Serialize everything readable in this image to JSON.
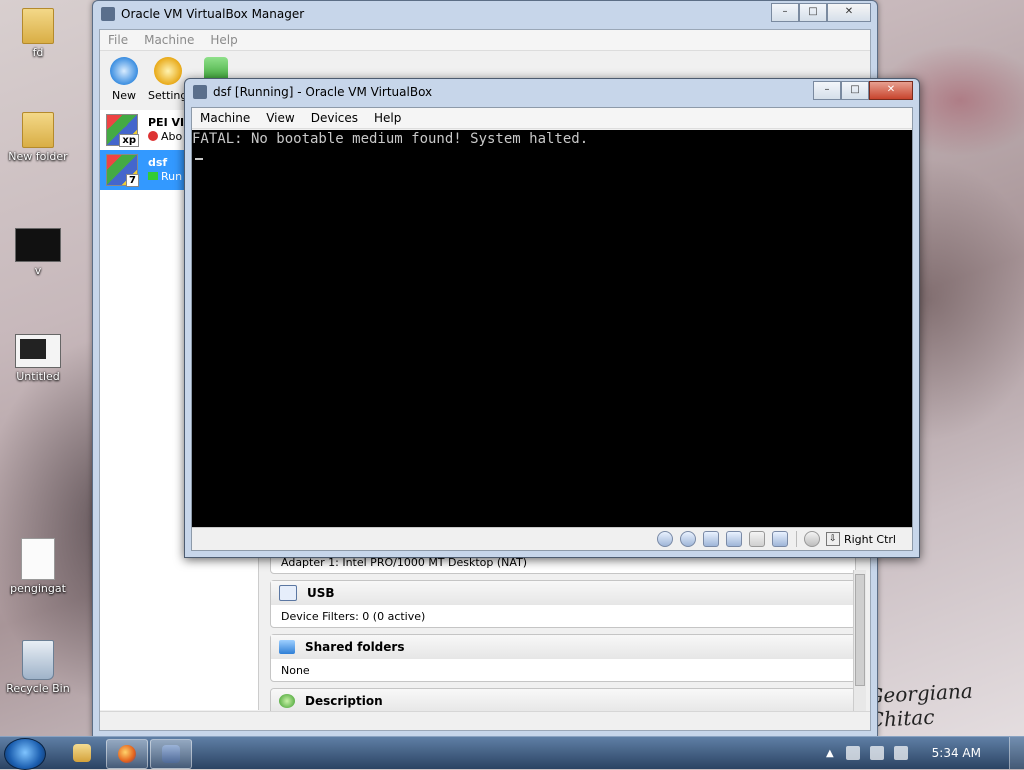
{
  "desktop": {
    "icons": [
      {
        "label": "fd"
      },
      {
        "label": "New folder"
      },
      {
        "label": "v"
      },
      {
        "label": "Untitled"
      },
      {
        "label": "pengingat"
      },
      {
        "label": "Recycle Bin"
      }
    ],
    "wallpaper_signature": "Georgiana Chitac"
  },
  "manager": {
    "title": "Oracle VM VirtualBox Manager",
    "menu": [
      "File",
      "Machine",
      "Help"
    ],
    "toolbar": {
      "new": "New",
      "settings": "Settings"
    },
    "vms": [
      {
        "name": "PEI VI",
        "state": "Abo",
        "badge": "xp"
      },
      {
        "name": "dsf",
        "state": "Run",
        "badge": "7"
      }
    ],
    "details": {
      "network_row": "Adapter 1:   Intel PRO/1000 MT Desktop (NAT)",
      "usb_title": "USB",
      "usb_row": "Device Filters:   0 (0 active)",
      "shared_title": "Shared folders",
      "shared_row": "None",
      "description_title": "Description"
    }
  },
  "vm_window": {
    "title": "dsf [Running] - Oracle VM VirtualBox",
    "menu": [
      "Machine",
      "View",
      "Devices",
      "Help"
    ],
    "console_text": "FATAL: No bootable medium found! System halted.",
    "host_key": "Right Ctrl"
  },
  "taskbar": {
    "clock": "5:34 AM"
  },
  "colors": {
    "selection": "#3399ff",
    "console_bg": "#000000",
    "console_fg": "#c8c8c8"
  }
}
